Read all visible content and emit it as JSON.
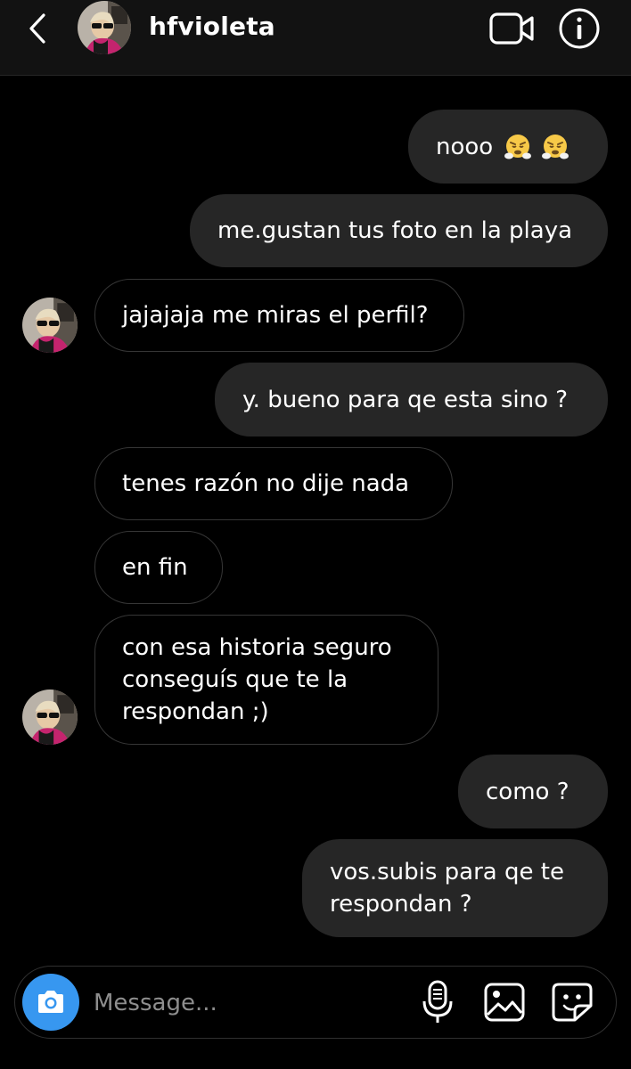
{
  "header": {
    "username": "hfvioleta",
    "back_icon": "chevron-left-icon",
    "video_icon": "video-camera-icon",
    "info_icon": "info-icon"
  },
  "messages": [
    {
      "side": "sent",
      "text": "nooo",
      "emojis": [
        "face-with-steam-from-nose",
        "face-with-steam-from-nose"
      ]
    },
    {
      "side": "sent",
      "text": "me.gustan tus foto en la playa"
    },
    {
      "side": "received",
      "text": "jajajaja me miras el perfil?",
      "avatar": true
    },
    {
      "side": "sent",
      "text": "y. bueno para qe esta sino ?"
    },
    {
      "side": "received",
      "text": "tenes razón no dije nada"
    },
    {
      "side": "received",
      "text": "en fin"
    },
    {
      "side": "received",
      "text": "con esa historia seguro\nconseguís que te la\nrespondan ;)",
      "avatar": true
    },
    {
      "side": "sent",
      "text": "como ?"
    },
    {
      "side": "sent",
      "text": "vos.subis para qe te\nrespondan ?"
    }
  ],
  "composer": {
    "placeholder": "Message...",
    "camera_icon": "camera-icon",
    "mic_icon": "microphone-icon",
    "gallery_icon": "gallery-icon",
    "sticker_icon": "sticker-icon"
  },
  "colors": {
    "background": "#000000",
    "header_bg": "#121212",
    "sent_bubble": "#262626",
    "received_border": "#363636",
    "accent": "#3797f0"
  }
}
